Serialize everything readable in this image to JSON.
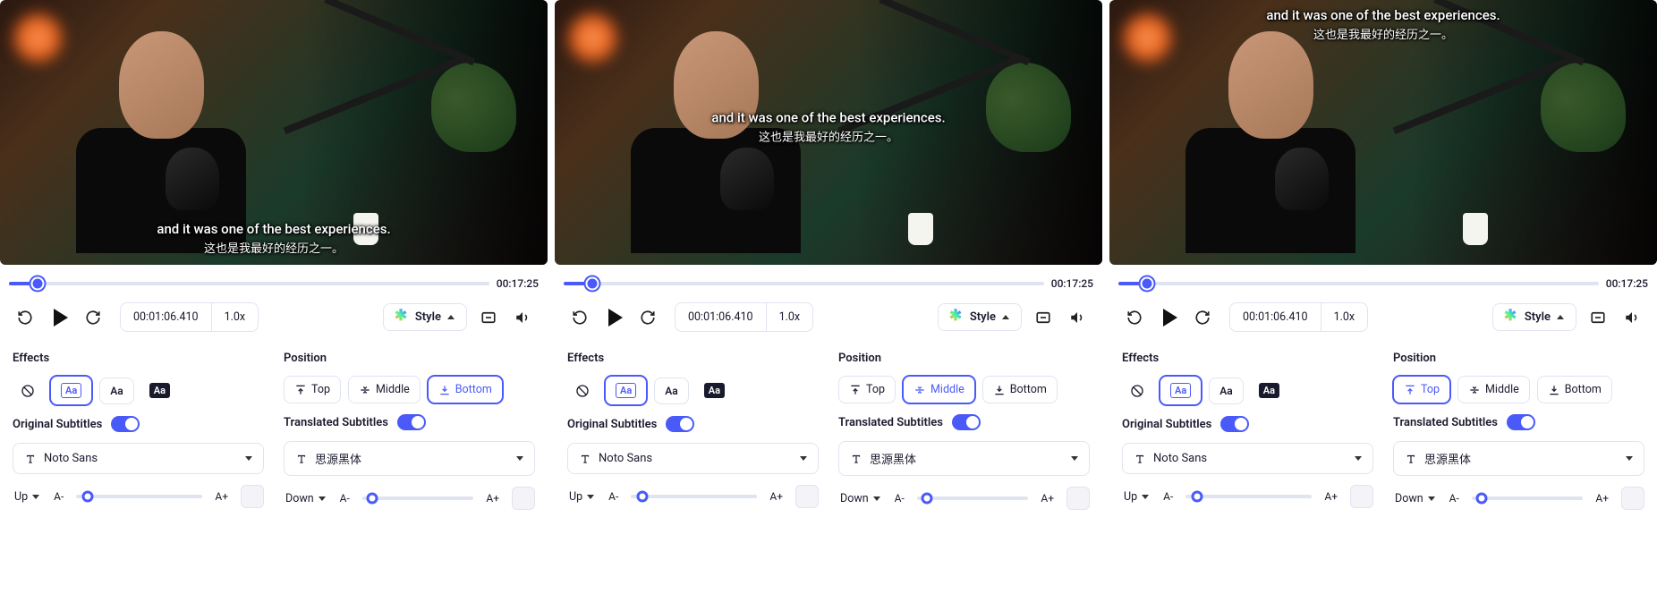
{
  "subtitles": {
    "original": "and it was one of the best experiences.",
    "translated": "这也是我最好的经历之一。"
  },
  "timeline": {
    "duration": "00:17:25",
    "current": "00:01:06.410",
    "speed": "1.0x"
  },
  "style_button": "Style",
  "labels": {
    "effects": "Effects",
    "position": "Position",
    "original_subs": "Original Subtitles",
    "translated_subs": "Translated Subtitles"
  },
  "positions": {
    "top": "Top",
    "middle": "Middle",
    "bottom": "Bottom"
  },
  "fonts": {
    "noto": "Noto Sans",
    "source_han": "思源黑体"
  },
  "size_labels": {
    "a_minus": "A-",
    "a_plus": "A+"
  },
  "offset": {
    "up": "Up",
    "down": "Down"
  },
  "effect_label": "Aa",
  "panels": [
    {
      "selected_position": "bottom",
      "subtitle_placement": "bottom"
    },
    {
      "selected_position": "middle",
      "subtitle_placement": "middle"
    },
    {
      "selected_position": "top",
      "subtitle_placement": "top"
    }
  ]
}
